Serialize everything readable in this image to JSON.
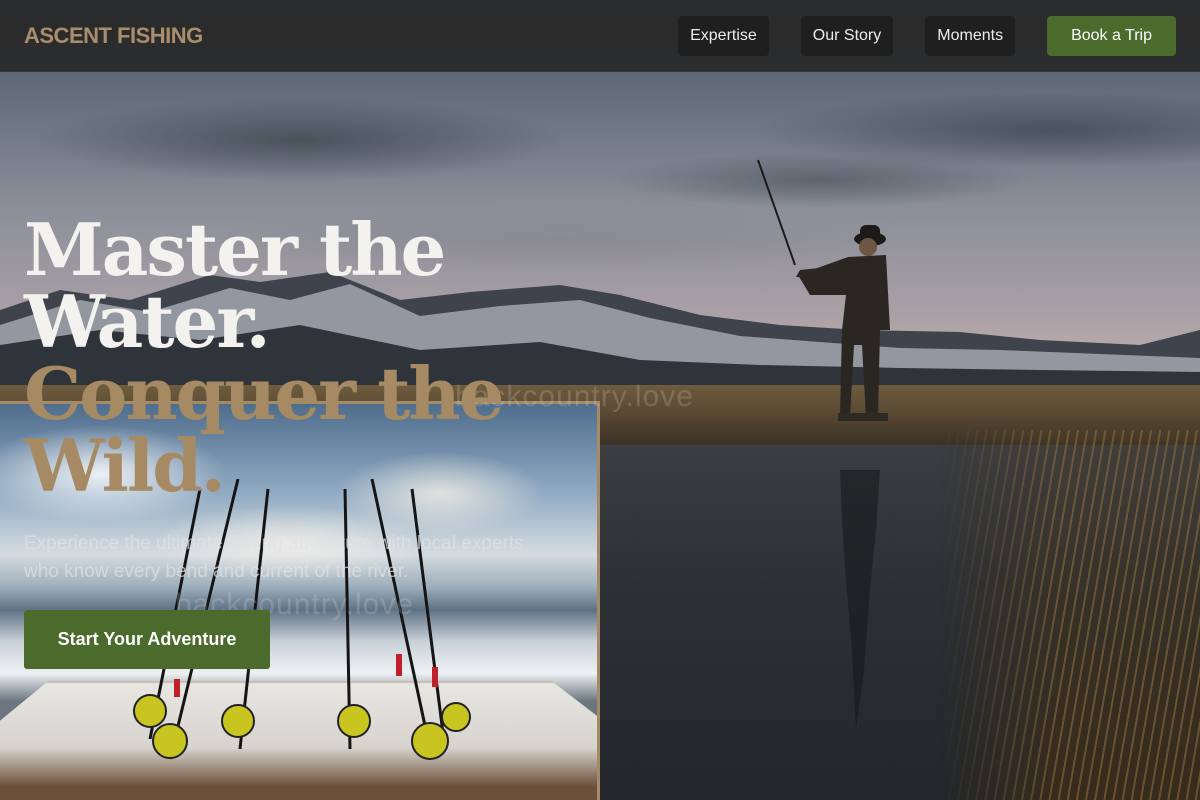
{
  "brand": {
    "name": "ASCENT FISHING"
  },
  "nav": {
    "links": [
      "Expertise",
      "Our Story",
      "Moments"
    ],
    "cta_label": "Book a Trip"
  },
  "hero": {
    "headline_line1": "Master the",
    "headline_line2": "Water.",
    "headline_accent_line1": "Conquer the",
    "headline_accent_line2": "Wild.",
    "lede": "Experience the ultimate fishing adventure with local experts who know every bend and current of the river.",
    "cta_label": "Start Your Adventure"
  },
  "watermarks": [
    "backcountry.love",
    "backcountry.love"
  ],
  "colors": {
    "brand": "#a88e6c",
    "accent_green": "#4a6b2c",
    "headline": "#f4f2ee",
    "headline_accent": "#a68a63",
    "nav_bg": "#282828",
    "inset_border": "#a48a65"
  }
}
